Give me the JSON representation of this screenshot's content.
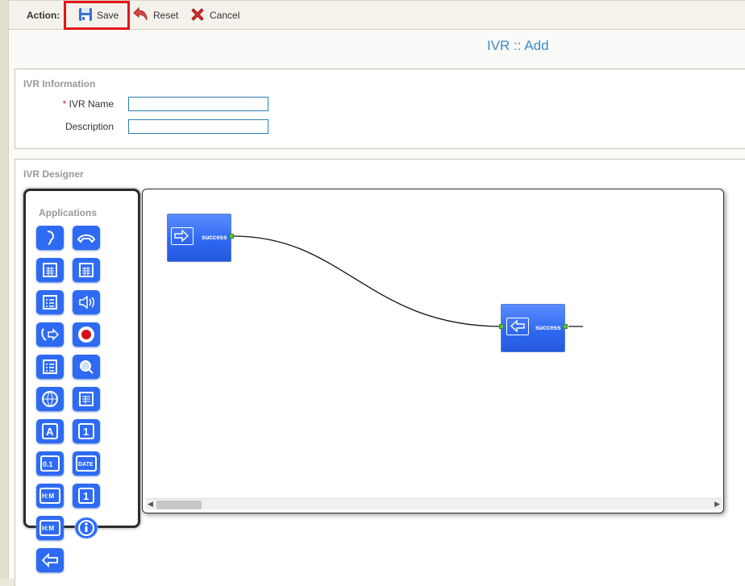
{
  "toolbar": {
    "action_label": "Action:",
    "save_label": "Save",
    "reset_label": "Reset",
    "cancel_label": "Cancel"
  },
  "page": {
    "title": "IVR :: Add"
  },
  "ivr_info": {
    "section_title": "IVR Information",
    "name_label": "IVR Name",
    "required_mark": "*",
    "name_value": "",
    "description_label": "Description",
    "description_value": ""
  },
  "designer": {
    "section_title": "IVR Designer",
    "palette_title": "Applications",
    "palette_icons": [
      "ear-icon",
      "hangup-icon",
      "calculator-icon",
      "calculator-icon",
      "checklist-icon",
      "speaker-icon",
      "call-transfer-icon",
      "record-icon",
      "checklist-icon",
      "search-icon",
      "globe-icon",
      "date-calc-icon",
      "say-alpha-icon",
      "say-digit-icon",
      "say-number-icon",
      "say-date-icon",
      "say-time-icon",
      "say-digit-icon",
      "say-time-icon",
      "info-icon",
      "exit-icon"
    ],
    "nodes": [
      {
        "name": "start-node",
        "icon": "enter-arrow-icon",
        "port_label": "success"
      },
      {
        "name": "exit-node",
        "icon": "exit-arrow-icon",
        "port_label": "success"
      }
    ]
  },
  "colors": {
    "accent": "#3c8cc4",
    "node_blue": "#2e6bf2",
    "highlight_red": "#e3141b",
    "port_green": "#5ac43a"
  }
}
